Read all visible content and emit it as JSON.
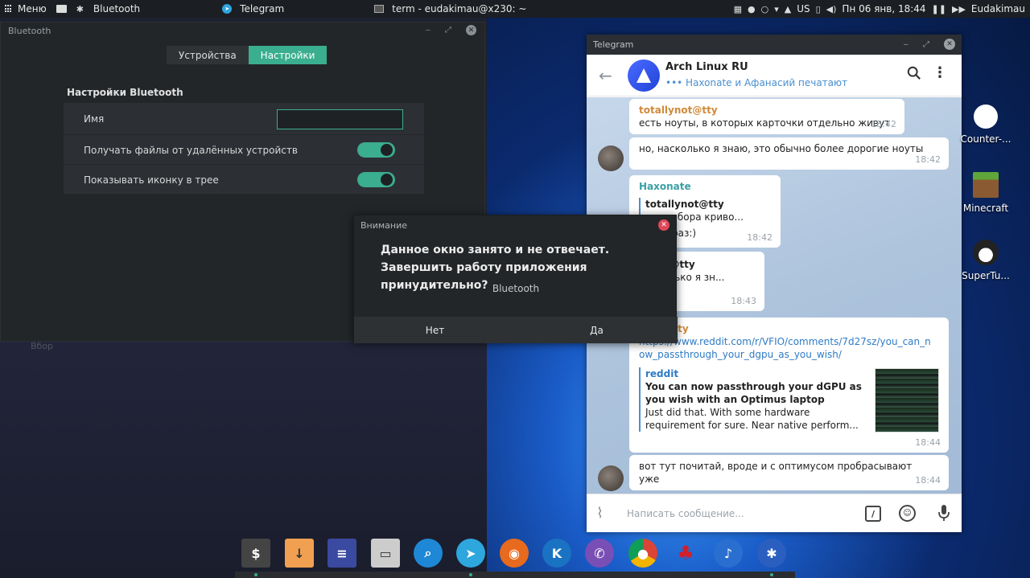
{
  "top_panel": {
    "menu_label": "Меню",
    "bluetooth_app": "Bluetooth",
    "telegram_app": "Telegram",
    "terminal_app": "term - eudakimau@x230: ~",
    "keyboard_layout": "US",
    "datetime": "Пн 06 янв, 18:44",
    "user": "Eudakimau"
  },
  "bluetooth_window": {
    "title": "Bluetooth",
    "tabs": [
      {
        "label": "Устройства",
        "active": false
      },
      {
        "label": "Настройки",
        "active": true
      }
    ],
    "section_title": "Настройки Bluetooth",
    "rows": {
      "name_label": "Имя",
      "name_value": "",
      "receive_files_label": "Получать файлы от удалённых устройств",
      "receive_files_on": true,
      "tray_icon_label": "Показывать иконку в трее",
      "tray_icon_on": true
    },
    "faded_text": "Вбор"
  },
  "dialog": {
    "title": "Внимание",
    "message_line1": "Данное окно занято и не отвечает.",
    "message_line2": "Завершить работу приложения принудительно?",
    "app_name": "Bluetooth",
    "no_label": "Нет",
    "yes_label": "Да"
  },
  "telegram": {
    "window_title": "Telegram",
    "chat_name": "Arch Linux RU",
    "chat_status": "••• Haxonate и Афанасий печатают",
    "messages": [
      {
        "author": "totallynot@tty",
        "text": "есть ноуты, в которых карточки отдельно живут",
        "time": "18:42"
      },
      {
        "author": "",
        "text": "но, насколько я знаю, это обычно более дорогие ноуты",
        "time": "18:42"
      },
      {
        "author": "Haxonate",
        "reply_author": "totallynot@tty",
        "reply_text": "с хероборa криво...",
        "text": "о ещё раз:)",
        "time": "18:42"
      },
      {
        "author": "",
        "reply_author": "ynot@tty",
        "reply_text": "асколько я зн...",
        "text": "о",
        "time": "18:43"
      },
      {
        "author": "ynot@tty",
        "link": "https://www.reddit.com/r/VFIO/comments/7d27sz/you_can_now_passthrough_your_dgpu_as_you_wish/",
        "preview_site": "reddit",
        "preview_title": "You can now passthrough your dGPU as you wish with an Optimus laptop",
        "preview_desc": "Just did that. With some hardware requirement for sure. Near native perform...",
        "time": "18:44"
      },
      {
        "author": "",
        "text": "вот тут почитай, вроде и с оптимусом пробрасывают уже",
        "time": "18:44"
      }
    ],
    "input_placeholder": "Написать сообщение..."
  },
  "desktop_icons": [
    {
      "label": "Counter-..."
    },
    {
      "label": "Minecraft"
    },
    {
      "label": "SuperTu..."
    }
  ]
}
